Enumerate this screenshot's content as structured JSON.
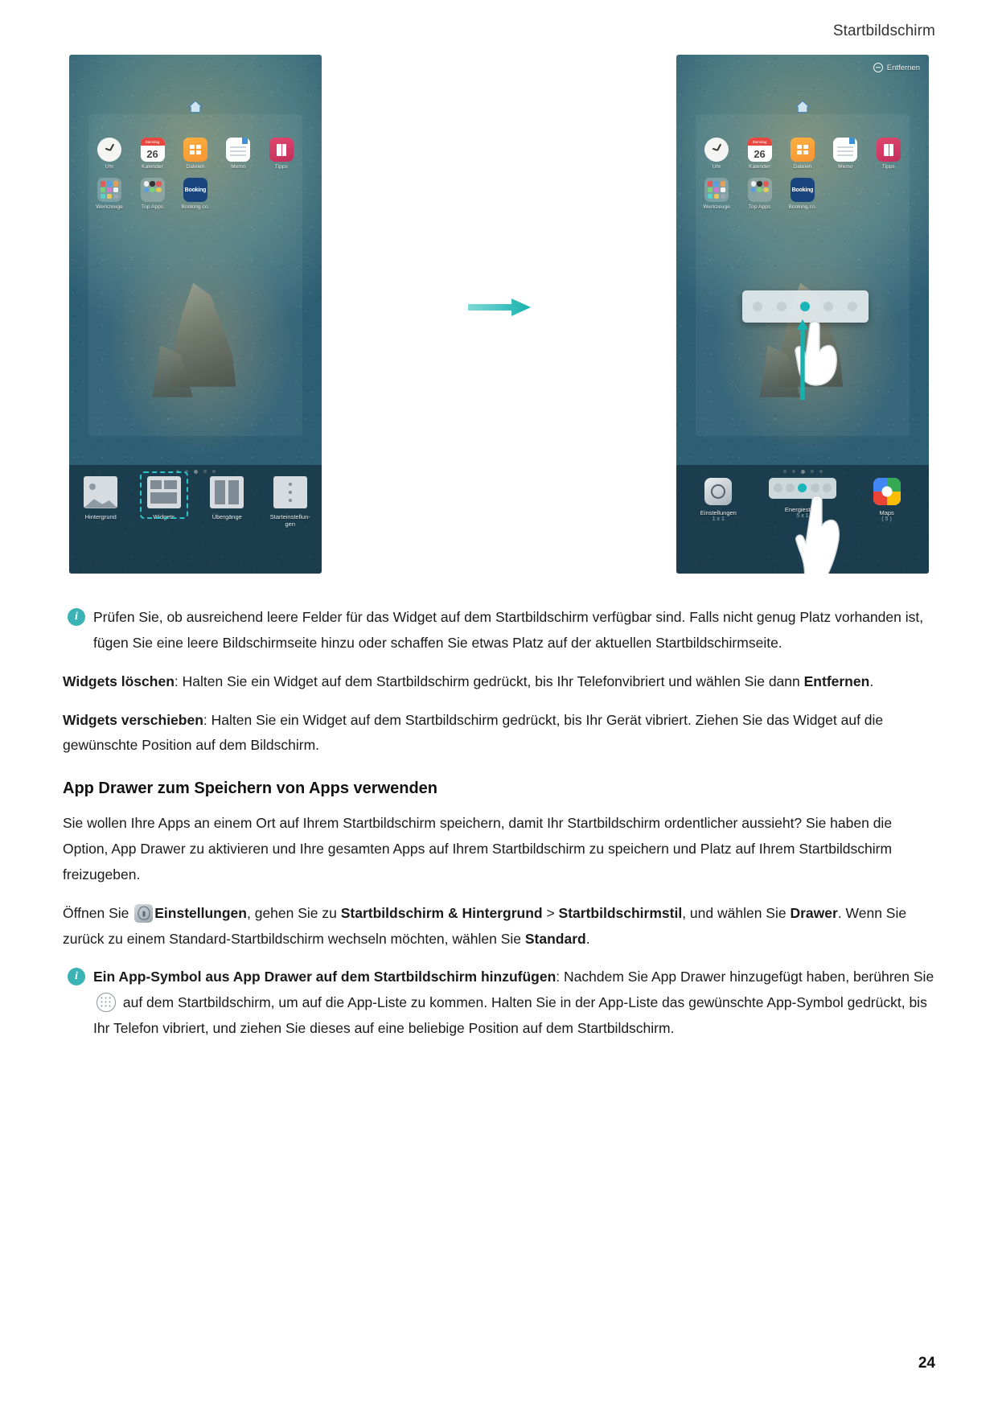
{
  "header": {
    "title": "Startbildschirm"
  },
  "figure": {
    "left_phone": {
      "home_icon": "home-icon",
      "apps_row1": [
        {
          "label": "Uhr",
          "icon": "clock-icon"
        },
        {
          "label": "Kalender",
          "icon": "calendar-icon",
          "weekday": "Dienstag",
          "day": "26"
        },
        {
          "label": "Dateien",
          "icon": "files-icon"
        },
        {
          "label": "Memo",
          "icon": "memo-icon"
        },
        {
          "label": "Tipps",
          "icon": "tips-icon"
        }
      ],
      "apps_row2": [
        {
          "label": "Werkzeuge",
          "icon": "tools-folder-icon"
        },
        {
          "label": "Top Apps",
          "icon": "top-apps-folder-icon"
        },
        {
          "label": "Booking.co.",
          "icon": "booking-icon",
          "text": "Booking"
        }
      ],
      "page_dots": 5,
      "active_dot": 2,
      "tray": [
        {
          "label": "Hintergrund",
          "selected": false
        },
        {
          "label": "Widgets",
          "selected": true
        },
        {
          "label": "Übergänge",
          "selected": false
        },
        {
          "label": "Starteinstellun-\ngen",
          "selected": false
        }
      ]
    },
    "right_phone": {
      "remove_chip": "Entfernen",
      "home_icon": "home-icon",
      "apps_row1": [
        {
          "label": "Uhr",
          "icon": "clock-icon"
        },
        {
          "label": "Kalender",
          "icon": "calendar-icon",
          "weekday": "Dienstag",
          "day": "26"
        },
        {
          "label": "Dateien",
          "icon": "files-icon"
        },
        {
          "label": "Memo",
          "icon": "memo-icon"
        },
        {
          "label": "Tipps",
          "icon": "tips-icon"
        }
      ],
      "apps_row2": [
        {
          "label": "Werkzeuge",
          "icon": "tools-folder-icon"
        },
        {
          "label": "Top Apps",
          "icon": "top-apps-folder-icon"
        },
        {
          "label": "Booking.co.",
          "icon": "booking-icon",
          "text": "Booking"
        }
      ],
      "page_dots": 5,
      "active_dot": 2,
      "tray": [
        {
          "label": "Einstellungen",
          "size": "1 x 1"
        },
        {
          "label": "Energiesteue",
          "size": "5 x 1"
        },
        {
          "label": "Maps",
          "size": "( 5 )"
        }
      ]
    },
    "arrow_icon": "right-arrow-icon"
  },
  "content": {
    "note1": "Prüfen Sie, ob ausreichend leere Felder für das Widget auf dem Startbildschirm verfügbar sind. Falls nicht genug Platz vorhanden ist, fügen Sie eine leere Bildschirmseite hinzu oder schaffen Sie etwas Platz auf der aktuellen Startbildschirmseite.",
    "para_delete": {
      "lead": "Widgets löschen",
      "mid": ": Halten Sie ein Widget auf dem Startbildschirm gedrückt, bis Ihr Telefonvibriert und wählen Sie dann ",
      "bold2": "Entfernen",
      "tail": "."
    },
    "para_move": {
      "lead": "Widgets verschieben",
      "rest": ": Halten Sie ein Widget auf dem Startbildschirm gedrückt, bis Ihr Gerät vibriert. Ziehen Sie das Widget auf die gewünschte Position auf dem Bildschirm."
    },
    "heading": "App Drawer zum Speichern von Apps verwenden",
    "para_intro": "Sie wollen Ihre Apps an einem Ort auf Ihrem Startbildschirm speichern, damit Ihr Startbildschirm ordentlicher aussieht? Sie haben die Option, App Drawer zu aktivieren und Ihre gesamten Apps auf Ihrem Startbildschirm zu speichern und Platz auf Ihrem Startbildschirm freizugeben.",
    "para_settings": {
      "p1": "Öffnen Sie ",
      "settings_icon": "settings-app-icon",
      "b1": "Einstellungen",
      "p2": ", gehen Sie zu ",
      "b2": "Startbildschirm & Hintergrund",
      "p3": " > ",
      "b3": "Startbildschirmstil",
      "p4": ", und wählen Sie ",
      "b4": "Drawer",
      "p5": ". Wenn Sie zurück zu einem Standard-Startbildschirm wechseln möchten, wählen Sie ",
      "b5": "Standard",
      "p6": "."
    },
    "note2": {
      "bold": "Ein App-Symbol aus App Drawer auf dem Startbildschirm hinzufügen",
      "t1": ": Nachdem Sie App Drawer hinzugefügt haben, berühren Sie ",
      "drawer_icon": "app-drawer-grid-icon",
      "t2": " auf dem Startbildschirm, um auf die App-Liste zu kommen. Halten Sie in der App-Liste das gewünschte App-Symbol gedrückt, bis Ihr Telefon vibriert, und ziehen Sie dieses auf eine beliebige Position auf dem Startbildschirm."
    }
  },
  "footer": {
    "page_number": "24"
  },
  "colors": {
    "accent_teal": "#3bb3b5",
    "selection_teal": "#2ec4c9",
    "text": "#1a1a1a"
  }
}
